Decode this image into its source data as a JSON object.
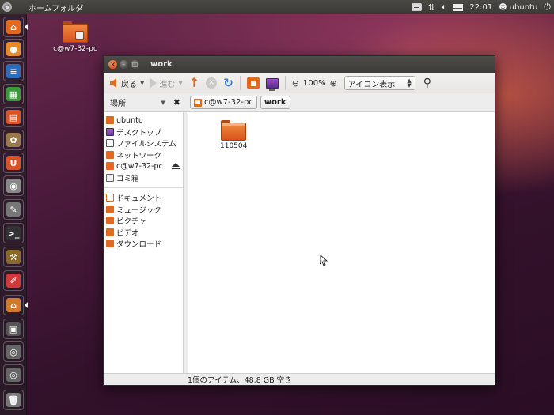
{
  "top_panel": {
    "app_title": "ホームフォルダ",
    "clock": "22:01",
    "user": "ubuntu"
  },
  "launcher": {
    "items": [
      {
        "name": "home-folder",
        "color": "#e06a20"
      },
      {
        "name": "firefox",
        "color": "#e88a2a"
      },
      {
        "name": "writer",
        "color": "#2f6db8"
      },
      {
        "name": "calc",
        "color": "#3b9a3b"
      },
      {
        "name": "impress",
        "color": "#d9532a"
      },
      {
        "name": "software-center",
        "color": "#9a7a4a"
      },
      {
        "name": "ubuntu-one",
        "color": "#d9532a"
      },
      {
        "name": "screenshot",
        "color": "#888888"
      },
      {
        "name": "text-editor",
        "color": "#777777"
      },
      {
        "name": "terminal",
        "color": "#333333"
      },
      {
        "name": "tools",
        "color": "#8a6a2a"
      },
      {
        "name": "pencils",
        "color": "#d03a3a"
      },
      {
        "name": "archive-folder",
        "color": "#d07a30"
      },
      {
        "name": "workspaces",
        "color": "#555555"
      },
      {
        "name": "search-apps",
        "color": "#666666"
      },
      {
        "name": "search-files",
        "color": "#666666"
      },
      {
        "name": "trash",
        "color": "#777777"
      }
    ]
  },
  "desktop": {
    "icon_label": "c@w7-32-pc"
  },
  "window": {
    "title": "work",
    "toolbar": {
      "back": "戻る",
      "forward": "進む",
      "zoom": "100%",
      "view_mode": "アイコン表示"
    },
    "places_label": "場所",
    "breadcrumbs": [
      "c@w7-32-pc",
      "work"
    ],
    "sidebar": {
      "devices": [
        {
          "label": "ubuntu",
          "icon": "home"
        },
        {
          "label": "デスクトップ",
          "icon": "desk"
        },
        {
          "label": "ファイルシステム",
          "icon": "fs"
        },
        {
          "label": "ネットワーク",
          "icon": "net"
        },
        {
          "label": "c@w7-32-pc",
          "icon": "smb"
        },
        {
          "label": "ゴミ箱",
          "icon": "trash"
        }
      ],
      "bookmarks": [
        {
          "label": "ドキュメント",
          "icon": "doc"
        },
        {
          "label": "ミュージック",
          "icon": "music"
        },
        {
          "label": "ピクチャ",
          "icon": "pic"
        },
        {
          "label": "ビデオ",
          "icon": "vid"
        },
        {
          "label": "ダウンロード",
          "icon": "dl"
        }
      ]
    },
    "files": [
      {
        "name": "110504",
        "type": "folder"
      }
    ],
    "status": "1個のアイテム、48.8 GB 空き"
  }
}
